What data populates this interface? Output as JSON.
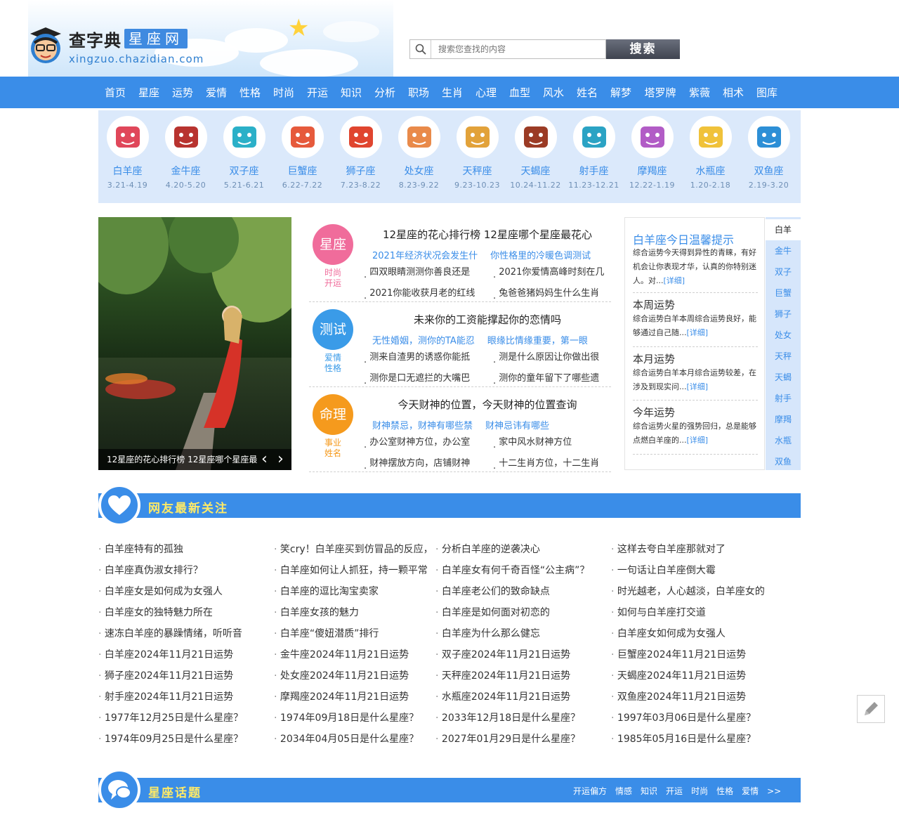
{
  "site": {
    "logo_big": "查字典",
    "logo_tag": "星座网",
    "logo_url": "xingzuo.chazidian.com"
  },
  "search": {
    "placeholder": "搜索您查找的内容",
    "button": "搜索"
  },
  "nav": [
    "首页",
    "星座",
    "运势",
    "爱情",
    "性格",
    "时尚",
    "开运",
    "知识",
    "分析",
    "职场",
    "生肖",
    "心理",
    "血型",
    "风水",
    "姓名",
    "解梦",
    "塔罗牌",
    "紫薇",
    "相术",
    "图库"
  ],
  "zodiac": [
    {
      "name": "白羊座",
      "date": "3.21-4.19",
      "icon": "aries-icon",
      "color": "#e0475a"
    },
    {
      "name": "金牛座",
      "date": "4.20-5.20",
      "icon": "taurus-icon",
      "color": "#b8332f"
    },
    {
      "name": "双子座",
      "date": "5.21-6.21",
      "icon": "gemini-icon",
      "color": "#2bb0c8"
    },
    {
      "name": "巨蟹座",
      "date": "6.22-7.22",
      "icon": "cancer-icon",
      "color": "#e65a3c"
    },
    {
      "name": "狮子座",
      "date": "7.23-8.22",
      "icon": "leo-icon",
      "color": "#e0452f"
    },
    {
      "name": "处女座",
      "date": "8.23-9.22",
      "icon": "virgo-icon",
      "color": "#e98a4a"
    },
    {
      "name": "天秤座",
      "date": "9.23-10.23",
      "icon": "libra-icon",
      "color": "#e2a23a"
    },
    {
      "name": "天蝎座",
      "date": "10.24-11.22",
      "icon": "scorpio-icon",
      "color": "#9b3b25"
    },
    {
      "name": "射手座",
      "date": "11.23-12.21",
      "icon": "sagittarius-icon",
      "color": "#2ba3c4"
    },
    {
      "name": "摩羯座",
      "date": "12.22-1.19",
      "icon": "capricorn-icon",
      "color": "#b25cc6"
    },
    {
      "name": "水瓶座",
      "date": "1.20-2.18",
      "icon": "aquarius-icon",
      "color": "#f0c23a"
    },
    {
      "name": "双鱼座",
      "date": "2.19-3.20",
      "icon": "pisces-icon",
      "color": "#2d8fd6"
    }
  ],
  "photo": {
    "caption": "12星座的花心排行榜 12星座哪个星座最"
  },
  "articles": [
    {
      "badge": "星座",
      "badge_color": "#f06c9b",
      "sub": [
        "时尚",
        "开运"
      ],
      "title": "12星座的花心排行榜  12星座哪个星座最花心",
      "links": [
        "2021年经济状况会发生什",
        "你性格里的冷暖色调测试"
      ],
      "list": [
        [
          "四双眼睛测测你善良还是",
          "2021你爱情高峰时刻在几"
        ],
        [
          "2021你能收获月老的红线",
          "兔爸爸猪妈妈生什么生肖"
        ]
      ]
    },
    {
      "badge": "测试",
      "badge_color": "#3a9be8",
      "sub": [
        "爱情",
        "性格"
      ],
      "title": "未来你的工资能撑起你的恋情吗",
      "links": [
        "无性婚姻，测你的TA能忍",
        "眼缘比情缘重要，第一眼"
      ],
      "list": [
        [
          "测来自渣男的诱惑你能抵",
          "测是什么原因让你做出很"
        ],
        [
          "测你是口无遮拦的大嘴巴",
          "测你的童年留下了哪些遗"
        ]
      ]
    },
    {
      "badge": "命理",
      "badge_color": "#f59a1d",
      "sub": [
        "事业",
        "姓名"
      ],
      "title": "今天财神的位置，今天财神的位置查询",
      "links": [
        "财神禁忌，财神有哪些禁",
        "财神忌讳有哪些"
      ],
      "list": [
        [
          "办公室财神方位，办公室",
          "家中风水财神方位"
        ],
        [
          "财神摆放方向，店铺财神",
          "十二生肖方位，十二生肖"
        ]
      ]
    }
  ],
  "tips": {
    "title": "白羊座今日温馨提示",
    "today": "综合运势今天得到异性的青睐，有好机会让你表现才华，认真的你特别迷人。对...",
    "more": "[详细]",
    "week_title": "本周运势",
    "week": "综合运势白羊本周综合运势良好，能够通过自己随...",
    "month_title": "本月运势",
    "month": "综合运势白羊本月综合运势较差，在涉及到现实问...",
    "year_title": "今年运势",
    "year": "综合运势火星的强势回归，总是能够点燃白羊座的..."
  },
  "sign_tabs": [
    "白羊",
    "金牛",
    "双子",
    "巨蟹",
    "狮子",
    "处女",
    "天秤",
    "天蝎",
    "射手",
    "摩羯",
    "水瓶",
    "双鱼"
  ],
  "section1": {
    "title": "网友最新关注"
  },
  "links_grid": [
    [
      "白羊座特有的孤独",
      "笑cry！白羊座买到仿冒品的反应，",
      "分析白羊座的逆袭决心",
      "这样去夸白羊座那就对了"
    ],
    [
      "白羊座真伪淑女排行？",
      "白羊座如何让人抓狂，持一颗平常",
      "白羊座女有何千奇百怪“公主病”？",
      "一句话让白羊座倒大霉"
    ],
    [
      "白羊座女是如何成为女强人",
      "白羊座的逗比淘宝卖家",
      "白羊座老公们的致命缺点",
      "时光越老，人心越淡，白羊座女的"
    ],
    [
      "白羊座女的独特魅力所在",
      "白羊座女孩的魅力",
      "白羊座是如何面对初恋的",
      "如何与白羊座打交道"
    ],
    [
      "速冻白羊座的暴躁情绪，听听音",
      "白羊座“傻妞潜质”排行",
      "白羊座为什么那么健忘",
      "白羊座女如何成为女强人"
    ],
    [
      "白羊座2024年11月21日运势",
      "金牛座2024年11月21日运势",
      "双子座2024年11月21日运势",
      "巨蟹座2024年11月21日运势"
    ],
    [
      "狮子座2024年11月21日运势",
      "处女座2024年11月21日运势",
      "天秤座2024年11月21日运势",
      "天蝎座2024年11月21日运势"
    ],
    [
      "射手座2024年11月21日运势",
      "摩羯座2024年11月21日运势",
      "水瓶座2024年11月21日运势",
      "双鱼座2024年11月21日运势"
    ],
    [
      "1977年12月25日是什么星座？",
      "1974年09月18日是什么星座？",
      "2033年12月18日是什么星座？",
      "1997年03月06日是什么星座？"
    ],
    [
      "1974年09月25日是什么星座？",
      "2034年04月05日是什么星座？",
      "2027年01月29日是什么星座？",
      "1985年05月16日是什么星座？"
    ]
  ],
  "section2": {
    "title": "星座话题",
    "links": [
      "开运偏方",
      "情感",
      "知识",
      "开运",
      "时尚",
      "性格",
      "爱情"
    ],
    "more": ">>"
  },
  "colors": {
    "primary": "#3a8de8",
    "nav_bg": "#3a8de8",
    "zodiac_bg": "#dbe9fb",
    "section_title": "#ffea66"
  }
}
